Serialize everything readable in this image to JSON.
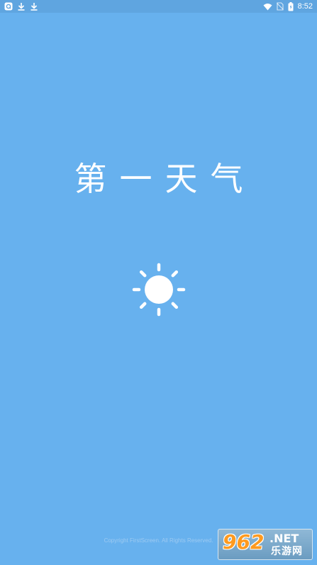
{
  "status_bar": {
    "time": "8:52",
    "left_icons": [
      "app-notification-icon",
      "download-icon",
      "download-icon"
    ],
    "right_icons": [
      "wifi-icon",
      "no-sim-icon",
      "battery-icon"
    ]
  },
  "splash": {
    "title": "第一天气",
    "icon": "sun-icon",
    "copyright": "Copyright FirstScreen. All Rights Reserved."
  },
  "watermark": {
    "number": "962",
    "domain": ".NET",
    "subtitle": "乐游网"
  },
  "colors": {
    "background": "#67B1EE",
    "status_bar": "#5FA5E0",
    "foreground": "#FFFFFF",
    "watermark_accent": "#FF9A1F"
  }
}
